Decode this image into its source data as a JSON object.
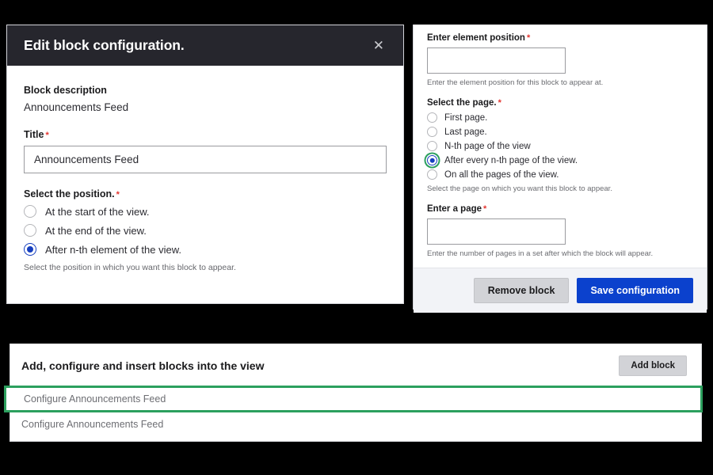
{
  "modal": {
    "title": "Edit block configuration.",
    "close_icon": "close-icon",
    "block_description_label": "Block description",
    "block_description_value": "Announcements Feed",
    "title_label": "Title",
    "title_value": "Announcements Feed",
    "title_placeholder": "",
    "position_label": "Select the position.",
    "position_help": "Select the position in which you want this block to appear.",
    "position_options": [
      {
        "label": "At the start of the view.",
        "checked": false
      },
      {
        "label": "At the end of the view.",
        "checked": false
      },
      {
        "label": "After n-th element of the view.",
        "checked": true
      }
    ],
    "required_marker": "*"
  },
  "right_panel": {
    "element_position_label": "Enter element position",
    "element_position_value": "",
    "element_position_placeholder": "",
    "element_position_help": "Enter the element position for this block to appear at.",
    "page_label": "Select the page.",
    "page_help": "Select the page on which you want this block to appear.",
    "page_options": [
      {
        "label": "First page.",
        "checked": false,
        "focused": false
      },
      {
        "label": "Last page.",
        "checked": false,
        "focused": false
      },
      {
        "label": "N-th page of the view",
        "checked": false,
        "focused": false
      },
      {
        "label": "After every n-th page of the view.",
        "checked": true,
        "focused": true
      },
      {
        "label": "On all the pages of the view.",
        "checked": false,
        "focused": false
      }
    ],
    "enter_page_label": "Enter a page",
    "enter_page_value": "",
    "enter_page_placeholder": "",
    "enter_page_help": "Enter the number of pages in a set after which the block will appear.",
    "remove_button": "Remove block",
    "save_button": "Save configuration",
    "required_marker": "*"
  },
  "bottom_panel": {
    "title": "Add, configure and insert blocks into the view",
    "add_block_button": "Add block",
    "rows": [
      {
        "label": "Configure Announcements Feed",
        "highlighted": true
      },
      {
        "label": "Configure Announcements Feed",
        "highlighted": false
      }
    ]
  },
  "colors": {
    "header_bg": "#26262d",
    "primary_blue": "#0b41cd",
    "radio_blue": "#163fbf",
    "focus_green": "#2ca05e",
    "required_red": "#e3342f",
    "footer_bg": "#f2f3f7",
    "secondary_button": "#d2d3d7",
    "page_bg": "#000000"
  }
}
